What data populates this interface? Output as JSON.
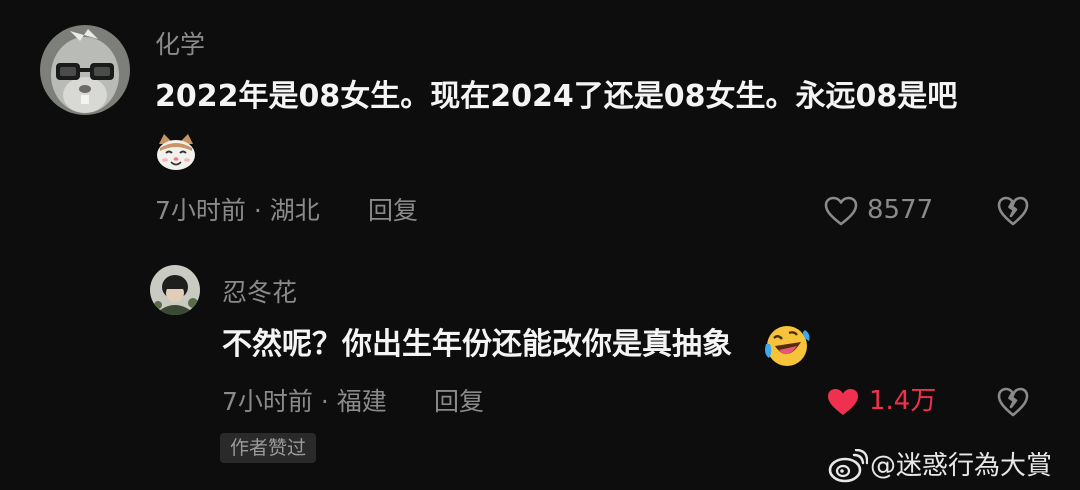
{
  "comment": {
    "username": "化学",
    "text": "2022年是08女生。现在2024了还是08女生。永远08是吧",
    "emoji_icon": "cat-face-emoji-icon",
    "meta": "7小时前 · 湖北",
    "reply_label": "回复",
    "like_count": "8577",
    "liked": false
  },
  "reply": {
    "username": "忍冬花",
    "text": "不然呢？你出生年份还能改你是真抽象",
    "emoji_icon": "rolling-laughing-emoji-icon",
    "meta": "7小时前 · 福建",
    "reply_label": "回复",
    "like_count": "1.4万",
    "liked": true,
    "badge": "作者赞过"
  },
  "watermark": {
    "text": "@迷惑行為大賞",
    "icon": "weibo-logo-icon"
  },
  "colors": {
    "background": "#0d0d0d",
    "text_primary": "#f4f4f4",
    "text_secondary": "#8a8a8a",
    "liked_red": "#f0304f",
    "badge_bg": "#2a2a2a"
  }
}
